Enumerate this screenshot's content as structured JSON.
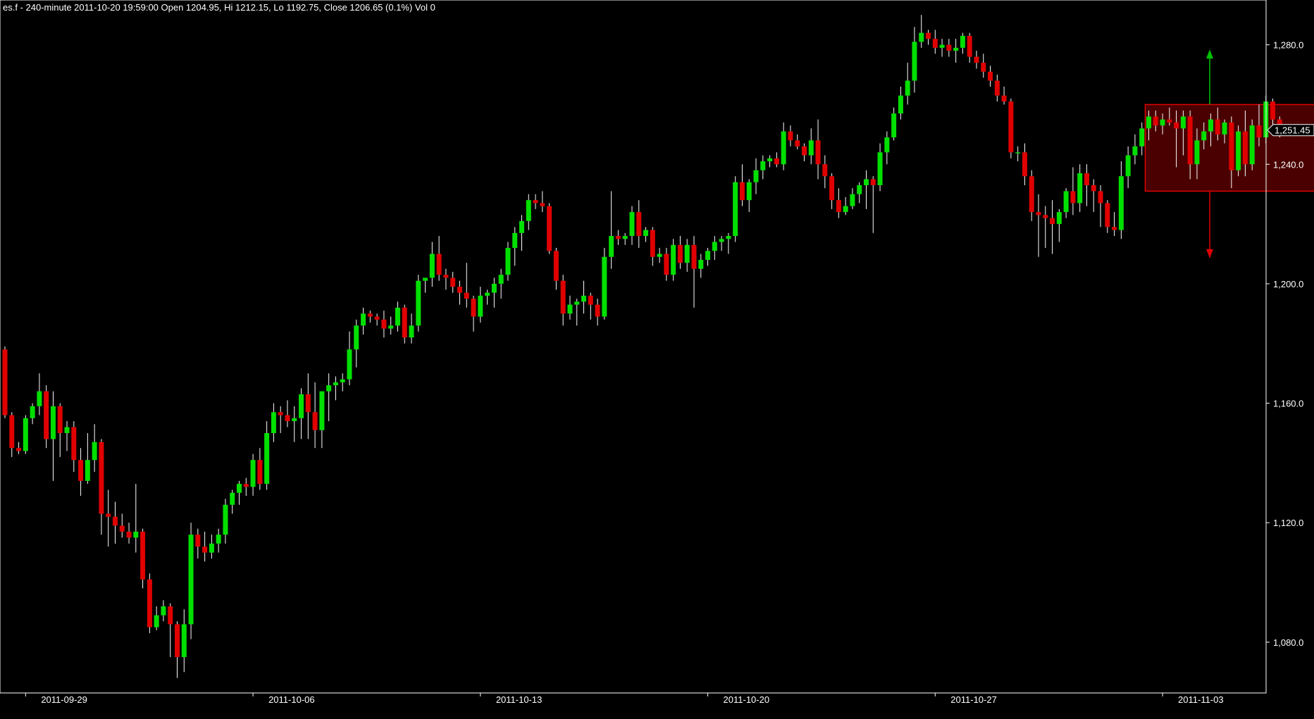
{
  "header": {
    "symbol": "es.f",
    "interval": "240-minute",
    "info": "es.f - 240-minute 2011-10-20 19:59:00 Open 1204.95, Hi 1212.15, Lo 1192.75, Close 1206.65 (0.1%) Vol 0"
  },
  "colors": {
    "background": "#000000",
    "up_candle": "#00e000",
    "down_candle": "#e00000",
    "wick": "#ffffff",
    "axis": "#ffffff",
    "range_box_fill": "#4a0000",
    "range_box_border": "#e00000",
    "up_arrow": "#00c000",
    "down_arrow": "#e00000"
  },
  "chart_data": {
    "type": "candlestick",
    "title": "",
    "xlabel": "",
    "ylabel": "",
    "ylim": [
      1063,
      1295
    ],
    "y_ticks": [
      "1,080.0",
      "1,120.0",
      "1,160.0",
      "1,200.0",
      "1,240.0",
      "1,280.0"
    ],
    "y_tick_values": [
      1080,
      1120,
      1160,
      1200,
      1240,
      1280
    ],
    "x_tick_labels": [
      "2011-09-29",
      "2011-10-06",
      "2011-10-13",
      "2011-10-20",
      "2011-10-27",
      "2011-11-03"
    ],
    "x_tick_index": [
      3,
      36,
      69,
      102,
      135,
      168
    ],
    "last_price_label": "1,251.45",
    "last_price": 1251.45,
    "range_box": {
      "start_index": 166,
      "end_index": 195,
      "high": 1260,
      "low": 1231,
      "up_target": 1278,
      "down_target": 1209
    },
    "candles": [
      [
        1178,
        1179,
        1155,
        1156
      ],
      [
        1156,
        1157,
        1142,
        1145
      ],
      [
        1145,
        1147,
        1143,
        1144
      ],
      [
        1144,
        1156,
        1143,
        1155
      ],
      [
        1155,
        1160,
        1153,
        1159
      ],
      [
        1159,
        1170,
        1156,
        1164
      ],
      [
        1164,
        1166,
        1145,
        1148
      ],
      [
        1148,
        1164,
        1134,
        1159
      ],
      [
        1159,
        1160,
        1142,
        1150
      ],
      [
        1150,
        1154,
        1144,
        1152
      ],
      [
        1152,
        1154,
        1137,
        1141
      ],
      [
        1141,
        1145,
        1129,
        1134
      ],
      [
        1134,
        1150,
        1133,
        1141
      ],
      [
        1141,
        1153,
        1137,
        1147
      ],
      [
        1147,
        1148,
        1116,
        1123
      ],
      [
        1123,
        1131,
        1112,
        1122
      ],
      [
        1122,
        1127,
        1113,
        1119
      ],
      [
        1119,
        1123,
        1115,
        1117
      ],
      [
        1117,
        1120,
        1113,
        1115
      ],
      [
        1115,
        1133,
        1110,
        1117
      ],
      [
        1117,
        1118,
        1098,
        1101
      ],
      [
        1101,
        1103,
        1083,
        1085
      ],
      [
        1085,
        1092,
        1084,
        1089
      ],
      [
        1089,
        1094,
        1087,
        1092
      ],
      [
        1092,
        1093,
        1075,
        1086
      ],
      [
        1086,
        1087,
        1068,
        1075
      ],
      [
        1075,
        1091,
        1070,
        1086
      ],
      [
        1086,
        1120,
        1081,
        1116
      ],
      [
        1116,
        1118,
        1108,
        1112
      ],
      [
        1112,
        1117,
        1107,
        1110
      ],
      [
        1110,
        1116,
        1108,
        1113
      ],
      [
        1113,
        1118,
        1110,
        1116
      ],
      [
        1116,
        1128,
        1113,
        1126
      ],
      [
        1126,
        1131,
        1123,
        1130
      ],
      [
        1130,
        1134,
        1126,
        1133
      ],
      [
        1133,
        1135,
        1129,
        1132
      ],
      [
        1132,
        1143,
        1129,
        1141
      ],
      [
        1141,
        1145,
        1131,
        1133
      ],
      [
        1133,
        1154,
        1131,
        1150
      ],
      [
        1150,
        1160,
        1147,
        1157
      ],
      [
        1157,
        1159,
        1150,
        1156
      ],
      [
        1156,
        1161,
        1152,
        1154
      ],
      [
        1154,
        1159,
        1147,
        1155
      ],
      [
        1155,
        1165,
        1148,
        1163
      ],
      [
        1163,
        1170,
        1148,
        1157
      ],
      [
        1157,
        1167,
        1145,
        1151
      ],
      [
        1151,
        1159,
        1145,
        1164
      ],
      [
        1164,
        1170,
        1154,
        1166
      ],
      [
        1166,
        1169,
        1161,
        1167
      ],
      [
        1167,
        1170,
        1164,
        1168
      ],
      [
        1168,
        1184,
        1166,
        1178
      ],
      [
        1178,
        1188,
        1172,
        1186
      ],
      [
        1186,
        1192,
        1183,
        1190
      ],
      [
        1190,
        1191,
        1187,
        1189
      ],
      [
        1189,
        1190,
        1186,
        1188
      ],
      [
        1188,
        1191,
        1182,
        1185
      ],
      [
        1185,
        1189,
        1183,
        1186
      ],
      [
        1186,
        1194,
        1184,
        1192
      ],
      [
        1192,
        1193,
        1180,
        1182
      ],
      [
        1182,
        1190,
        1180,
        1186
      ],
      [
        1186,
        1203,
        1184,
        1201
      ],
      [
        1201,
        1202,
        1197,
        1202
      ],
      [
        1202,
        1214,
        1199,
        1210
      ],
      [
        1210,
        1216,
        1201,
        1203
      ],
      [
        1203,
        1205,
        1198,
        1202
      ],
      [
        1202,
        1204,
        1197,
        1199
      ],
      [
        1199,
        1201,
        1193,
        1197
      ],
      [
        1197,
        1207,
        1192,
        1195
      ],
      [
        1195,
        1196,
        1184,
        1189
      ],
      [
        1189,
        1199,
        1187,
        1196
      ],
      [
        1196,
        1198,
        1193,
        1197
      ],
      [
        1197,
        1202,
        1192,
        1200
      ],
      [
        1200,
        1205,
        1195,
        1203
      ],
      [
        1203,
        1214,
        1201,
        1212
      ],
      [
        1212,
        1219,
        1206,
        1217
      ],
      [
        1217,
        1223,
        1211,
        1221
      ],
      [
        1221,
        1230,
        1218,
        1228
      ],
      [
        1228,
        1230,
        1225,
        1227
      ],
      [
        1227,
        1231,
        1224,
        1226
      ],
      [
        1226,
        1227,
        1210,
        1211
      ],
      [
        1211,
        1212,
        1198,
        1201
      ],
      [
        1201,
        1203,
        1186,
        1190
      ],
      [
        1190,
        1196,
        1188,
        1193
      ],
      [
        1193,
        1195,
        1186,
        1194
      ],
      [
        1194,
        1201,
        1190,
        1196
      ],
      [
        1196,
        1197,
        1188,
        1193
      ],
      [
        1193,
        1195,
        1186,
        1189
      ],
      [
        1189,
        1212,
        1188,
        1209
      ],
      [
        1209,
        1231,
        1205,
        1216
      ],
      [
        1216,
        1218,
        1213,
        1215
      ],
      [
        1215,
        1217,
        1213,
        1216
      ],
      [
        1216,
        1226,
        1213,
        1224
      ],
      [
        1224,
        1228,
        1212,
        1216
      ],
      [
        1216,
        1219,
        1214,
        1218
      ],
      [
        1218,
        1219,
        1206,
        1209
      ],
      [
        1209,
        1212,
        1207,
        1210
      ],
      [
        1210,
        1212,
        1201,
        1203
      ],
      [
        1203,
        1215,
        1201,
        1213
      ],
      [
        1213,
        1216,
        1205,
        1207
      ],
      [
        1207,
        1215,
        1204,
        1213
      ],
      [
        1213,
        1216,
        1192,
        1205
      ],
      [
        1205,
        1210,
        1202,
        1208
      ],
      [
        1208,
        1212,
        1206,
        1211
      ],
      [
        1211,
        1216,
        1208,
        1214
      ],
      [
        1214,
        1216,
        1211,
        1215
      ],
      [
        1215,
        1217,
        1210,
        1216
      ],
      [
        1216,
        1236,
        1214,
        1234
      ],
      [
        1234,
        1240,
        1226,
        1228
      ],
      [
        1228,
        1235,
        1224,
        1234
      ],
      [
        1234,
        1242,
        1230,
        1238
      ],
      [
        1238,
        1243,
        1235,
        1241
      ],
      [
        1241,
        1243,
        1239,
        1242
      ],
      [
        1242,
        1244,
        1239,
        1240
      ],
      [
        1240,
        1254,
        1238,
        1251
      ],
      [
        1251,
        1253,
        1246,
        1248
      ],
      [
        1248,
        1250,
        1245,
        1246
      ],
      [
        1246,
        1247,
        1241,
        1243
      ],
      [
        1243,
        1252,
        1240,
        1248
      ],
      [
        1248,
        1255,
        1235,
        1240
      ],
      [
        1240,
        1243,
        1232,
        1236
      ],
      [
        1236,
        1237,
        1225,
        1228
      ],
      [
        1228,
        1232,
        1222,
        1224
      ],
      [
        1224,
        1229,
        1223,
        1226
      ],
      [
        1226,
        1232,
        1225,
        1230
      ],
      [
        1230,
        1234,
        1227,
        1233
      ],
      [
        1233,
        1238,
        1225,
        1235
      ],
      [
        1235,
        1236,
        1217,
        1233
      ],
      [
        1233,
        1247,
        1231,
        1244
      ],
      [
        1244,
        1251,
        1240,
        1249
      ],
      [
        1249,
        1259,
        1248,
        1257
      ],
      [
        1257,
        1266,
        1255,
        1263
      ],
      [
        1263,
        1274,
        1260,
        1268
      ],
      [
        1268,
        1286,
        1264,
        1281
      ],
      [
        1281,
        1290,
        1279,
        1284
      ],
      [
        1284,
        1285,
        1280,
        1282
      ],
      [
        1282,
        1285,
        1277,
        1279
      ],
      [
        1279,
        1282,
        1276,
        1280
      ],
      [
        1280,
        1282,
        1276,
        1278
      ],
      [
        1278,
        1282,
        1274,
        1279
      ],
      [
        1279,
        1284,
        1277,
        1283
      ],
      [
        1283,
        1284,
        1274,
        1276
      ],
      [
        1276,
        1278,
        1272,
        1274
      ],
      [
        1274,
        1277,
        1269,
        1271
      ],
      [
        1271,
        1273,
        1266,
        1268
      ],
      [
        1268,
        1270,
        1261,
        1263
      ],
      [
        1263,
        1266,
        1260,
        1261
      ],
      [
        1261,
        1262,
        1242,
        1244
      ],
      [
        1244,
        1246,
        1241,
        1244
      ],
      [
        1244,
        1247,
        1233,
        1236
      ],
      [
        1236,
        1238,
        1221,
        1224
      ],
      [
        1224,
        1230,
        1209,
        1223
      ],
      [
        1223,
        1226,
        1212,
        1222
      ],
      [
        1222,
        1228,
        1210,
        1220
      ],
      [
        1220,
        1225,
        1214,
        1224
      ],
      [
        1224,
        1232,
        1222,
        1231
      ],
      [
        1231,
        1239,
        1223,
        1227
      ],
      [
        1227,
        1240,
        1224,
        1237
      ],
      [
        1237,
        1240,
        1226,
        1233
      ],
      [
        1233,
        1235,
        1224,
        1231
      ],
      [
        1231,
        1233,
        1219,
        1227
      ],
      [
        1227,
        1228,
        1217,
        1219
      ],
      [
        1219,
        1224,
        1216,
        1218
      ],
      [
        1218,
        1241,
        1215,
        1236
      ],
      [
        1236,
        1246,
        1232,
        1243
      ],
      [
        1243,
        1250,
        1240,
        1246
      ],
      [
        1246,
        1254,
        1243,
        1252
      ],
      [
        1252,
        1258,
        1248,
        1256
      ],
      [
        1256,
        1258,
        1251,
        1253
      ],
      [
        1253,
        1257,
        1250,
        1255
      ],
      [
        1255,
        1259,
        1253,
        1254
      ],
      [
        1254,
        1258,
        1239,
        1252
      ],
      [
        1252,
        1258,
        1243,
        1256
      ],
      [
        1256,
        1258,
        1235,
        1240
      ],
      [
        1240,
        1252,
        1235,
        1248
      ],
      [
        1248,
        1254,
        1245,
        1251
      ],
      [
        1251,
        1257,
        1246,
        1255
      ],
      [
        1255,
        1259,
        1248,
        1250
      ],
      [
        1250,
        1255,
        1247,
        1254
      ],
      [
        1254,
        1256,
        1232,
        1238
      ],
      [
        1238,
        1253,
        1236,
        1251
      ],
      [
        1251,
        1258,
        1236,
        1240
      ],
      [
        1240,
        1255,
        1238,
        1253
      ],
      [
        1253,
        1260,
        1246,
        1249
      ],
      [
        1249,
        1263,
        1247,
        1261
      ],
      [
        1261,
        1262,
        1253,
        1255
      ],
      [
        1255,
        1256,
        1249,
        1251
      ]
    ]
  }
}
